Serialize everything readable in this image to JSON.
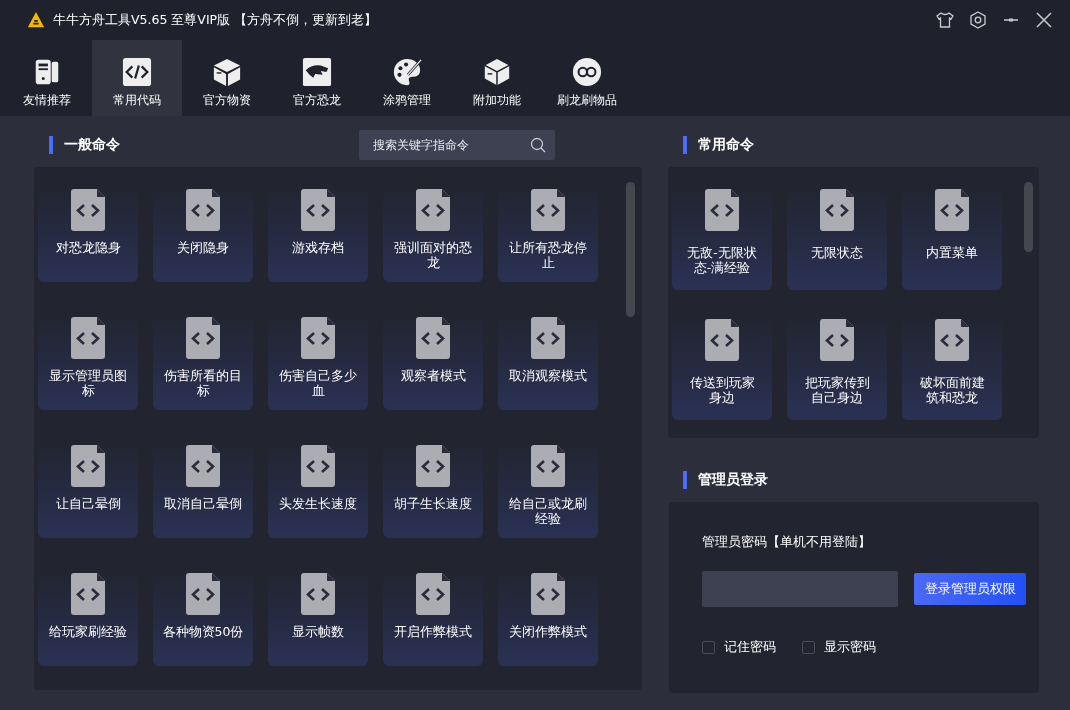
{
  "window": {
    "title": "牛牛方舟工具V5.65 至尊VIP版 【方舟不倒，更新到老】"
  },
  "tabs": [
    {
      "label": "友情推荐",
      "selected": false
    },
    {
      "label": "常用代码",
      "selected": true
    },
    {
      "label": "官方物资",
      "selected": false
    },
    {
      "label": "官方恐龙",
      "selected": false
    },
    {
      "label": "涂鸦管理",
      "selected": false
    },
    {
      "label": "附加功能",
      "selected": false
    },
    {
      "label": "刷龙刷物品",
      "selected": false
    }
  ],
  "general_commands": {
    "title": "一般命令",
    "search": {
      "placeholder": "搜索关键字指命令"
    },
    "items": [
      "对恐龙隐身",
      "关闭隐身",
      "游戏存档",
      "强训面对的恐龙",
      "让所有恐龙停止",
      "显示管理员图标",
      "伤害所看的目标",
      "伤害自己多少血",
      "观察者模式",
      "取消观察模式",
      "让自己晕倒",
      "取消自己晕倒",
      "头发生长速度",
      "胡子生长速度",
      "给自己或龙刷经验",
      "给玩家刷经验",
      "各种物资50份",
      "显示帧数",
      "开启作弊模式",
      "关闭作弊模式"
    ]
  },
  "common_commands": {
    "title": "常用命令",
    "items": [
      "无敌-无限状态-满经验",
      "无限状态",
      "内置菜单",
      "传送到玩家身边",
      "把玩家传到自己身边",
      "破坏面前建筑和恐龙"
    ]
  },
  "admin_login": {
    "title": "管理员登录",
    "label": "管理员密码【单机不用登陆】",
    "login_button": "登录管理员权限",
    "options": [
      {
        "label": "记住密码",
        "checked": false
      },
      {
        "label": "显示密码",
        "checked": false
      }
    ]
  }
}
